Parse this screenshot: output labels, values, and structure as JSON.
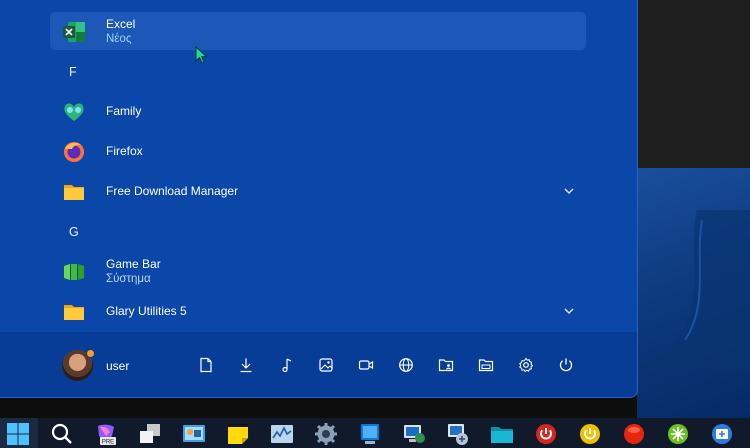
{
  "start_menu": {
    "apps": [
      {
        "name": "Excel",
        "subtitle": "Νέος",
        "icon": "excel-icon",
        "highlighted": true
      },
      {
        "name": "Family",
        "subtitle": "",
        "icon": "family-icon"
      },
      {
        "name": "Firefox",
        "subtitle": "",
        "icon": "firefox-icon"
      },
      {
        "name": "Free Download Manager",
        "subtitle": "",
        "icon": "folder-icon",
        "expandable": true
      },
      {
        "name": "Game Bar",
        "subtitle": "Σύστημα",
        "icon": "game-bar-icon"
      },
      {
        "name": "Glary Utilities 5",
        "subtitle": "",
        "icon": "folder-icon",
        "expandable": true
      }
    ],
    "letters": [
      "F",
      "G"
    ],
    "user": {
      "name": "user",
      "status_color": "#ff9d1c"
    },
    "footer_icons": [
      "documents-icon",
      "downloads-icon",
      "music-icon",
      "pictures-icon",
      "videos-icon",
      "network-icon",
      "personal-folder-icon",
      "file-explorer-icon",
      "settings-icon",
      "power-icon"
    ]
  },
  "taskbar": {
    "icons": [
      "windows-start-icon",
      "search-icon",
      "copilot-pre-icon",
      "task-view-icon",
      "control-panel-icon",
      "sticky-notes-icon",
      "resource-monitor-icon",
      "settings-gear-icon",
      "blue-app-icon",
      "remote-desktop-icon",
      "network-settings-icon",
      "teal-folder-icon",
      "red-power-app-icon",
      "yellow-power-app-icon",
      "red-round-app-icon",
      "green-app-icon",
      "snipping-app-icon"
    ]
  },
  "colors": {
    "menu_bg": "#0a47a8",
    "highlight": "#1d58b8",
    "subtitle_new": "#9fd2ff",
    "footer_bg": "#083d97"
  }
}
